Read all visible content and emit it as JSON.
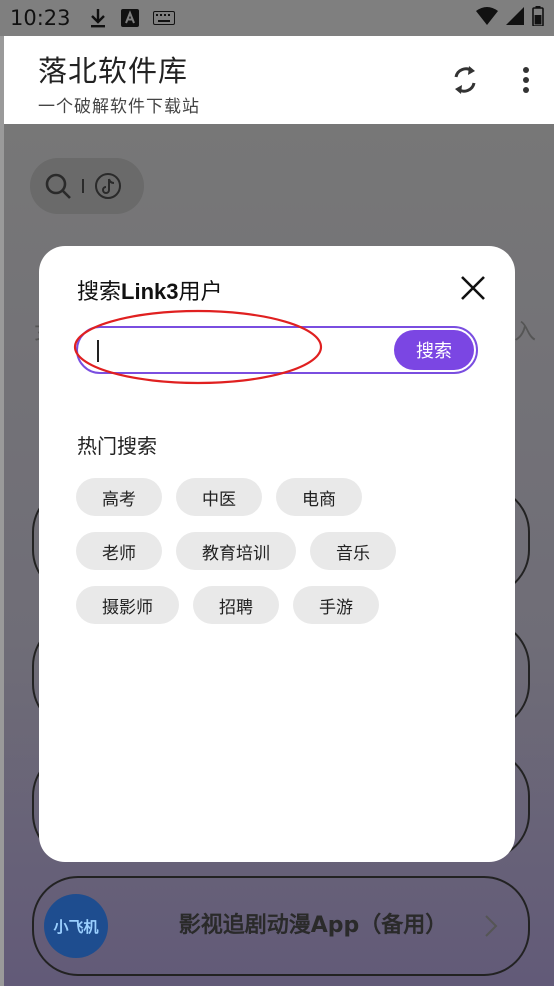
{
  "status_bar": {
    "time": "10:23",
    "icons": [
      "download-icon",
      "font-app-icon",
      "keyboard-icon",
      "wifi-icon",
      "signal-icon",
      "battery-icon"
    ]
  },
  "app_bar": {
    "title": "落北软件库",
    "subtitle": "一个破解软件下载站",
    "actions": [
      "refresh-icon",
      "more-vert-icon"
    ]
  },
  "background": {
    "card_4_title": "影视追剧动漫App（备用）",
    "card_4_logo": "小飞机",
    "ghost_left": "女",
    "ghost_right": "入"
  },
  "modal": {
    "title_prefix": "搜索",
    "title_bold": "Link3",
    "title_suffix": "用户",
    "search_value": "",
    "search_button": "搜索",
    "hot_title": "热门搜索",
    "hot_tags": [
      [
        "高考",
        "中医",
        "电商"
      ],
      [
        "老师",
        "教育培训",
        "音乐"
      ],
      [
        "摄影师",
        "招聘",
        "手游"
      ]
    ]
  },
  "colors": {
    "accent": "#7b46e3",
    "annotation": "#e02020"
  }
}
